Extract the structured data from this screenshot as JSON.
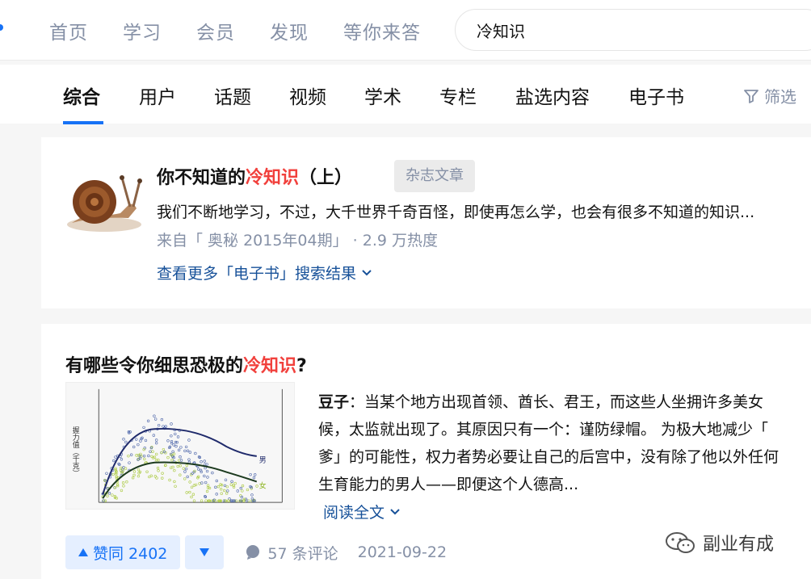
{
  "topnav": {
    "items": [
      "首页",
      "学习",
      "会员",
      "发现",
      "等你来答"
    ],
    "search_value": "冷知识"
  },
  "tabs": {
    "items": [
      "综合",
      "用户",
      "话题",
      "视频",
      "学术",
      "专栏",
      "盐选内容",
      "电子书"
    ],
    "active": "综合",
    "filter_label": "筛选"
  },
  "card1": {
    "title_prefix": "你不知道的",
    "title_highlight": "冷知识",
    "title_suffix": "（上）",
    "badge": "杂志文章",
    "excerpt": "我们不断地学习，不过，大千世界千奇百怪，即使再怎么学，也会有很多不知道的知识...",
    "meta": "来自「 奥秘 2015年04期」 · 2.9 万热度",
    "more_link": "查看更多「电子书」搜索结果"
  },
  "card2": {
    "title_prefix": "有哪些令你细思恐极的",
    "title_highlight": "冷知识",
    "title_suffix": "?",
    "excerpt_author": "豆子",
    "excerpt_lines": [
      "：当某个地方出现首领、酋长、君王，而这些人坐拥许多美女",
      "候，太监就出现了。其原因只有一个：谨防绿帽。 为极大地减少「",
      "爹」的可能性，权力者势必要让自己的后宫中，没有除了他以外任何",
      "生育能力的男人——即便这个人德高..."
    ],
    "read_more": "阅读全文",
    "vote_up": "赞同 2402",
    "comments": "57 条评论",
    "date": "2021-09-22",
    "thumb": {
      "ylabel": "握力值（千克）",
      "legend_male": "男",
      "legend_female": "女"
    }
  },
  "watermark": "副业有成",
  "colors": {
    "accent": "#1772f6",
    "highlight": "#f1403c",
    "link": "#175199",
    "muted": "#8590a6"
  }
}
